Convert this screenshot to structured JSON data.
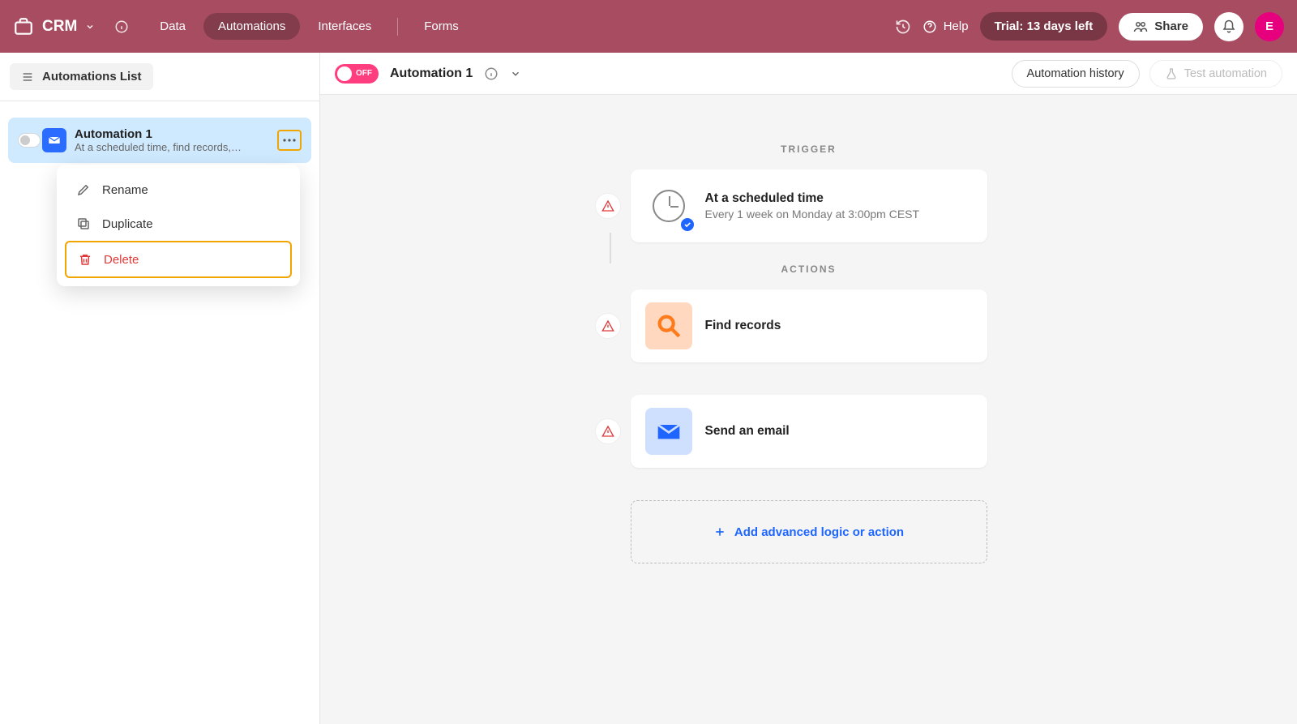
{
  "brand": "CRM",
  "nav": {
    "data": "Data",
    "automations": "Automations",
    "interfaces": "Interfaces",
    "forms": "Forms"
  },
  "top": {
    "help": "Help",
    "trial": "Trial: 13 days left",
    "share": "Share",
    "avatar_initial": "E"
  },
  "sidebar": {
    "list_button": "Automations List",
    "card": {
      "title": "Automation 1",
      "subtitle": "At a scheduled time, find records,…"
    },
    "menu": {
      "rename": "Rename",
      "duplicate": "Duplicate",
      "delete": "Delete"
    }
  },
  "header": {
    "switch": "OFF",
    "name": "Automation 1",
    "history": "Automation history",
    "test": "Test automation"
  },
  "flow": {
    "trigger_label": "TRIGGER",
    "actions_label": "ACTIONS",
    "trigger": {
      "title": "At a scheduled time",
      "subtitle": "Every 1 week on Monday at 3:00pm CEST"
    },
    "action1": {
      "title": "Find records"
    },
    "action2": {
      "title": "Send an email"
    },
    "add": "Add advanced logic or action"
  }
}
